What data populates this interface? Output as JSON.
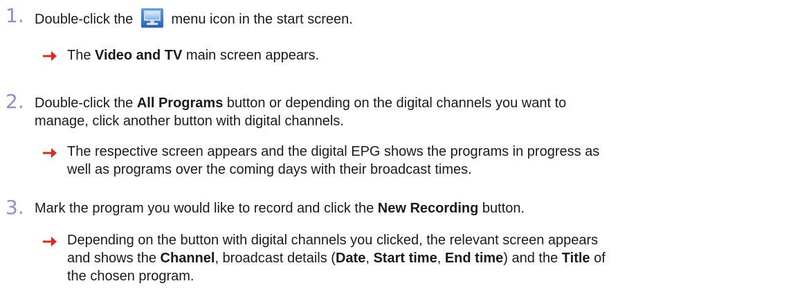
{
  "colors": {
    "step_number": "#8a8fd0",
    "arrow": "#e0281a"
  },
  "steps": [
    {
      "number": "1.",
      "line1_before": "Double-click the",
      "icon": "tv-monitor-icon",
      "line1_after": "menu icon in the start screen.",
      "result": [
        {
          "plain1": "The ",
          "bold1": "Video and TV",
          "plain2": " main screen appears."
        }
      ]
    },
    {
      "number": "2.",
      "line1": {
        "plain1": "Double-click the ",
        "bold1": "All Programs",
        "plain2": " button or depending on the digital channels you want to"
      },
      "line2": "manage, click another button with digital channels.",
      "result_line1": "The respective screen appears and the digital EPG shows the programs in progress as",
      "result_line2": "well as programs over the coming days with their broadcast times."
    },
    {
      "number": "3.",
      "line1": {
        "plain1": "Mark the program you would like to record and click the ",
        "bold1": "New Recording",
        "plain2": " button."
      },
      "result_line1": "Depending on the button with digital channels you clicked, the relevant screen appears",
      "result_line2": {
        "p1": "and shows the ",
        "b1": "Channel",
        "p2": ", broadcast details (",
        "b2": "Date",
        "p3": ", ",
        "b3": "Start time",
        "p4": ", ",
        "b4": "End time",
        "p5": ") and the ",
        "b5": "Title",
        "p6": " of"
      },
      "result_line3": "the chosen program."
    }
  ]
}
